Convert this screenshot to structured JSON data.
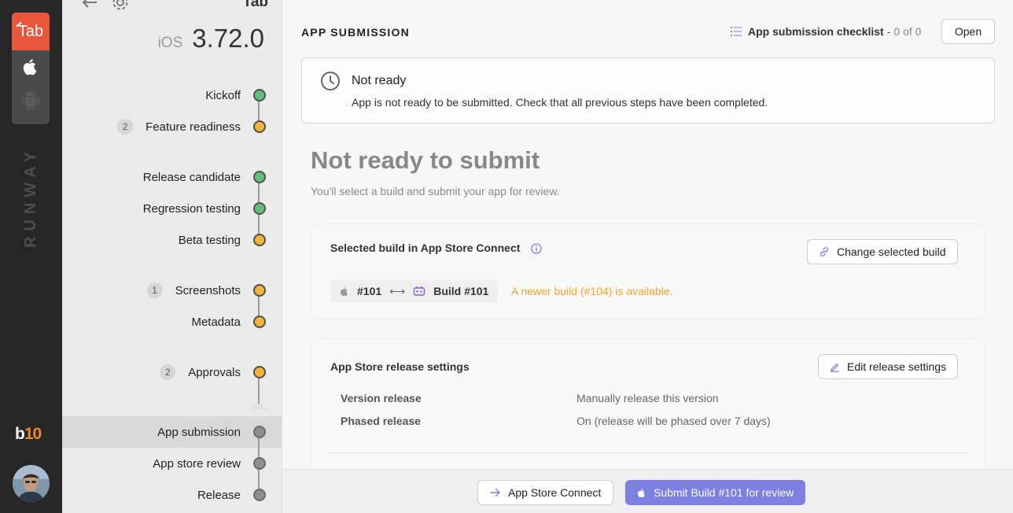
{
  "rail": {
    "app_tab_label": "Tab",
    "brand_vertical": "RUNWAY",
    "logo_b": "b",
    "logo_10": "10"
  },
  "sidebar": {
    "app_name": "Tab",
    "platform": "iOS",
    "version": "3.72.0",
    "steps": [
      {
        "label": "Kickoff",
        "count": "",
        "status": "green"
      },
      {
        "label": "Feature readiness",
        "count": "2",
        "status": "amber"
      },
      {
        "label": "Release candidate",
        "count": "",
        "status": "green"
      },
      {
        "label": "Regression testing",
        "count": "",
        "status": "green"
      },
      {
        "label": "Beta testing",
        "count": "",
        "status": "amber"
      },
      {
        "label": "Screenshots",
        "count": "1",
        "status": "amber"
      },
      {
        "label": "Metadata",
        "count": "",
        "status": "amber"
      },
      {
        "label": "Approvals",
        "count": "2",
        "status": "amber"
      },
      {
        "label": "App submission",
        "count": "",
        "status": "gray"
      },
      {
        "label": "App store review",
        "count": "",
        "status": "gray"
      },
      {
        "label": "Release",
        "count": "",
        "status": "gray"
      }
    ]
  },
  "header": {
    "title": "APP SUBMISSION",
    "checklist_label": "App submission checklist",
    "checklist_dash": "-",
    "checklist_count": "0 of 0",
    "open_label": "Open"
  },
  "notice": {
    "title": "Not ready",
    "description": "App is not ready to be submitted. Check that all previous steps have been completed."
  },
  "main": {
    "title": "Not ready to submit",
    "subtitle": "You'll select a build and submit your app for review."
  },
  "build_card": {
    "title": "Selected build in App Store Connect",
    "change_label": "Change selected build",
    "ios_build": "#101",
    "arrow": "⟷",
    "build_label": "Build #101",
    "newer_notice": "A newer build (#104) is available."
  },
  "release_card": {
    "title": "App Store release settings",
    "edit_label": "Edit release settings",
    "rows": [
      {
        "key": "Version release",
        "value": "Manually release this version"
      },
      {
        "key": "Phased release",
        "value": "On (release will be phased over 7 days)"
      }
    ]
  },
  "footer": {
    "asc_label": "App Store Connect",
    "submit_label": "Submit Build #101 for review"
  },
  "colors": {
    "accent": "#7a7fe0",
    "warning": "#f2a529",
    "green": "#64bf7a",
    "amber": "#f2b43b",
    "brand_orange": "#e8573a"
  }
}
